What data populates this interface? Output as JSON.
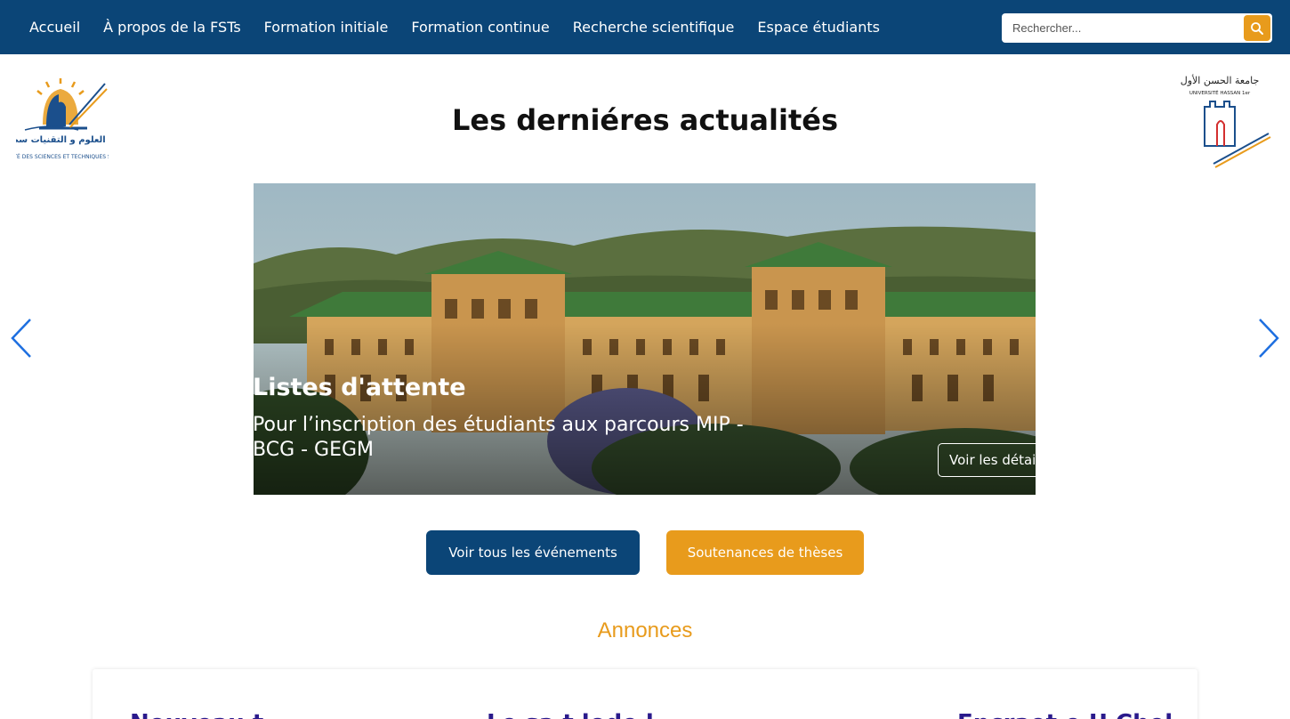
{
  "nav": {
    "items": [
      "Accueil",
      "À propos de la FSTs",
      "Formation initiale",
      "Formation continue",
      "Recherche scientifique",
      "Espace étudiants"
    ],
    "search_placeholder": "Rechercher..."
  },
  "logos": {
    "left_arabic": "كلية العلوم و التقنيات سطات",
    "left_french": "FACULTÉ DES SCIENCES ET TECHNIQUES SETTAT",
    "right_arabic": "جامعة الحسن الأول",
    "right_french": "UNIVERSITÉ HASSAN 1er"
  },
  "news": {
    "title": "Les derniéres actualités",
    "slide": {
      "title": "Listes d'attente",
      "description": "Pour l’inscription des étudiants aux parcours MIP - BCG - GEGM",
      "button": "Voir les détails"
    }
  },
  "buttons": {
    "events": "Voir tous les événements",
    "theses": "Soutenances de thèses"
  },
  "announcements": {
    "title": "Annonces",
    "cards": [
      "Nouveau t",
      "Le sa t lode l",
      "Encraet e U Chel"
    ]
  },
  "colors": {
    "nav_bg": "#0b4577",
    "accent": "#e89b1c",
    "card_heading": "#2a1a8c"
  }
}
